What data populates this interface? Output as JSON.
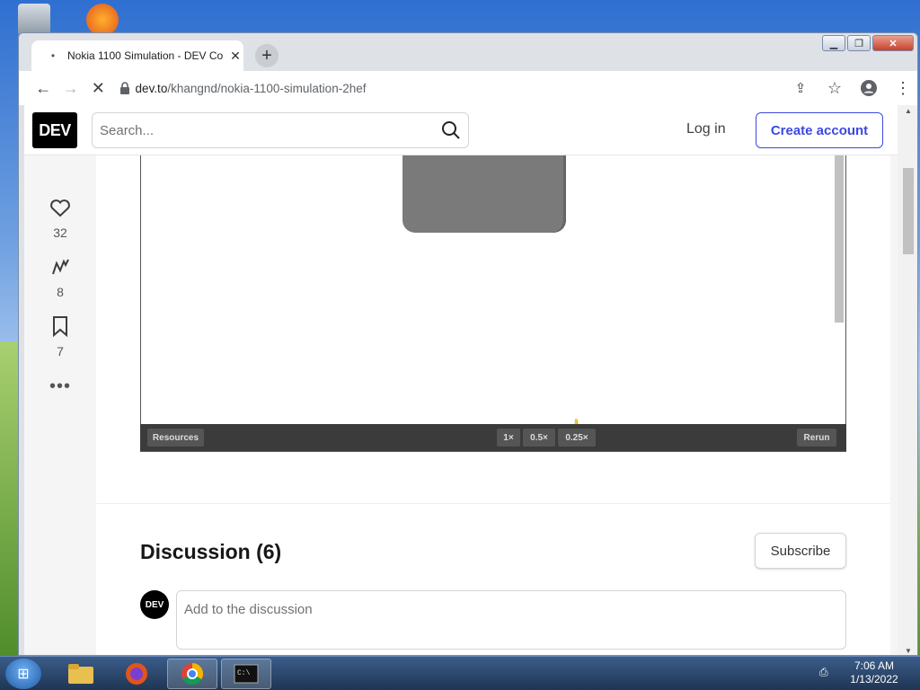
{
  "browser": {
    "tab_title": "Nokia 1100 Simulation - DEV Co",
    "url_host": "dev.to",
    "url_path": "/khangnd/nokia-1100-simulation-2hef"
  },
  "header": {
    "logo": "DEV",
    "search_placeholder": "Search...",
    "login_label": "Log in",
    "create_account_label": "Create account"
  },
  "reactions": [
    {
      "icon": "heart-icon",
      "count": "32"
    },
    {
      "icon": "unicorn-icon",
      "count": "8"
    },
    {
      "icon": "bookmark-icon",
      "count": "7"
    }
  ],
  "embed": {
    "resources_label": "Resources",
    "speed_1x": "1×",
    "speed_05x": "0.5×",
    "speed_025x": "0.25×",
    "rerun_label": "Rerun"
  },
  "discussion": {
    "title": "Discussion (6)",
    "subscribe_label": "Subscribe",
    "avatar_text": "DEV",
    "comment_placeholder": "Add to the discussion"
  },
  "taskbar": {
    "time": "7:06 AM",
    "date": "1/13/2022"
  }
}
